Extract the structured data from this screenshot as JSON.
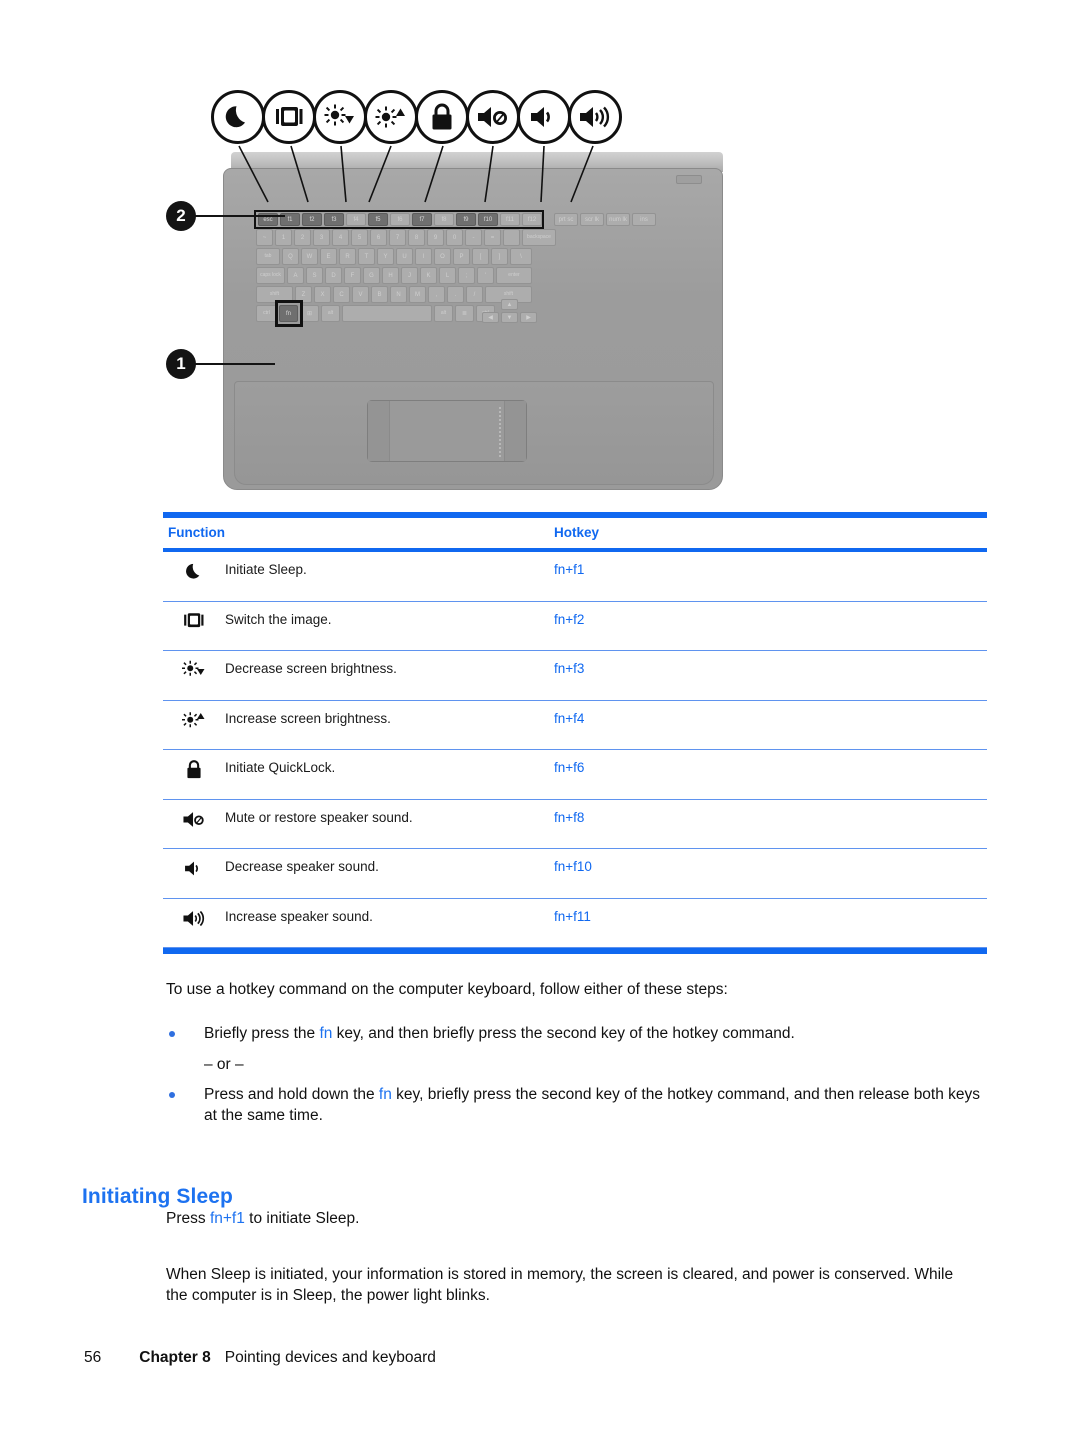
{
  "figure": {
    "callout_icons": [
      {
        "name": "sleep-moon-icon",
        "label": "Initiate Sleep"
      },
      {
        "name": "switch-image-icon",
        "label": "Switch the image"
      },
      {
        "name": "brightness-down-icon",
        "label": "Decrease screen brightness"
      },
      {
        "name": "brightness-up-icon",
        "label": "Increase screen brightness"
      },
      {
        "name": "lock-icon",
        "label": "Initiate QuickLock"
      },
      {
        "name": "speaker-mute-icon",
        "label": "Mute or restore speaker sound"
      },
      {
        "name": "volume-down-icon",
        "label": "Decrease speaker sound"
      },
      {
        "name": "volume-up-icon",
        "label": "Increase speaker sound"
      }
    ],
    "numbered_callouts": [
      {
        "number": "1",
        "target": "fn-key"
      },
      {
        "number": "2",
        "target": "function-keys-row"
      }
    ],
    "keyboard_rows": [
      [
        "esc",
        "f1",
        "f2",
        "f3",
        "f4",
        "f5",
        "f6",
        "f7",
        "f8",
        "f9",
        "f10",
        "f11",
        "f12",
        "prt sc",
        "scr lk",
        "num lk",
        "ins"
      ],
      [
        "~",
        "1",
        "2",
        "3",
        "4",
        "5",
        "6",
        "7",
        "8",
        "9",
        "0",
        "-",
        "=",
        "backspace"
      ],
      [
        "tab",
        "Q",
        "W",
        "E",
        "R",
        "T",
        "Y",
        "U",
        "I",
        "O",
        "P",
        "[",
        "]",
        "\\"
      ],
      [
        "caps lock",
        "A",
        "S",
        "D",
        "F",
        "G",
        "H",
        "J",
        "K",
        "L",
        ";",
        "'",
        "enter"
      ],
      [
        "shift",
        "Z",
        "X",
        "C",
        "V",
        "B",
        "N",
        "M",
        ",",
        ".",
        "/",
        "shift"
      ],
      [
        "ctrl",
        "fn",
        "win",
        "alt",
        "space",
        "alt",
        "menu",
        "ctrl",
        "arrows"
      ]
    ]
  },
  "table": {
    "headers": {
      "function": "Function",
      "hotkey": "Hotkey"
    },
    "rows": [
      {
        "icon": "sleep-moon-icon",
        "function": "Initiate Sleep.",
        "hotkey": "fn+f1"
      },
      {
        "icon": "switch-image-icon",
        "function": "Switch the image.",
        "hotkey": "fn+f2"
      },
      {
        "icon": "brightness-down-icon",
        "function": "Decrease screen brightness.",
        "hotkey": "fn+f3"
      },
      {
        "icon": "brightness-up-icon",
        "function": "Increase screen brightness.",
        "hotkey": "fn+f4"
      },
      {
        "icon": "lock-icon",
        "function": "Initiate QuickLock.",
        "hotkey": "fn+f6"
      },
      {
        "icon": "speaker-mute-icon",
        "function": "Mute or restore speaker sound.",
        "hotkey": "fn+f8"
      },
      {
        "icon": "volume-down-icon",
        "function": "Decrease speaker sound.",
        "hotkey": "fn+f10"
      },
      {
        "icon": "volume-up-icon",
        "function": "Increase speaker sound.",
        "hotkey": "fn+f11"
      }
    ]
  },
  "content": {
    "lead": "To use a hotkey command on the computer keyboard, follow either of these steps:",
    "bullet1_before": "Briefly press the ",
    "bullet1_key": "fn",
    "bullet1_after": " key, and then briefly press the second key of the hotkey command.",
    "or_text": "– or –",
    "bullet2_before": "Press and hold down the ",
    "bullet2_key": "fn",
    "bullet2_after": " key, briefly press the second key of the hotkey command, and then release both keys at the same time.",
    "heading": "Initiating Sleep",
    "press_before": "Press ",
    "press_key": "fn+f1",
    "press_after": " to initiate Sleep.",
    "sleep_paragraph": "When Sleep is initiated, your information is stored in memory, the screen is cleared, and power is conserved. While the computer is in Sleep, the power light blinks."
  },
  "footer": {
    "page": "56",
    "chapter": "Chapter 8",
    "title": "Pointing devices and keyboard"
  },
  "colors": {
    "accent_blue": "#1068f0",
    "rule_blue": "#5f93ef",
    "heading_blue": "#1d72f0",
    "text_black": "#111111"
  }
}
